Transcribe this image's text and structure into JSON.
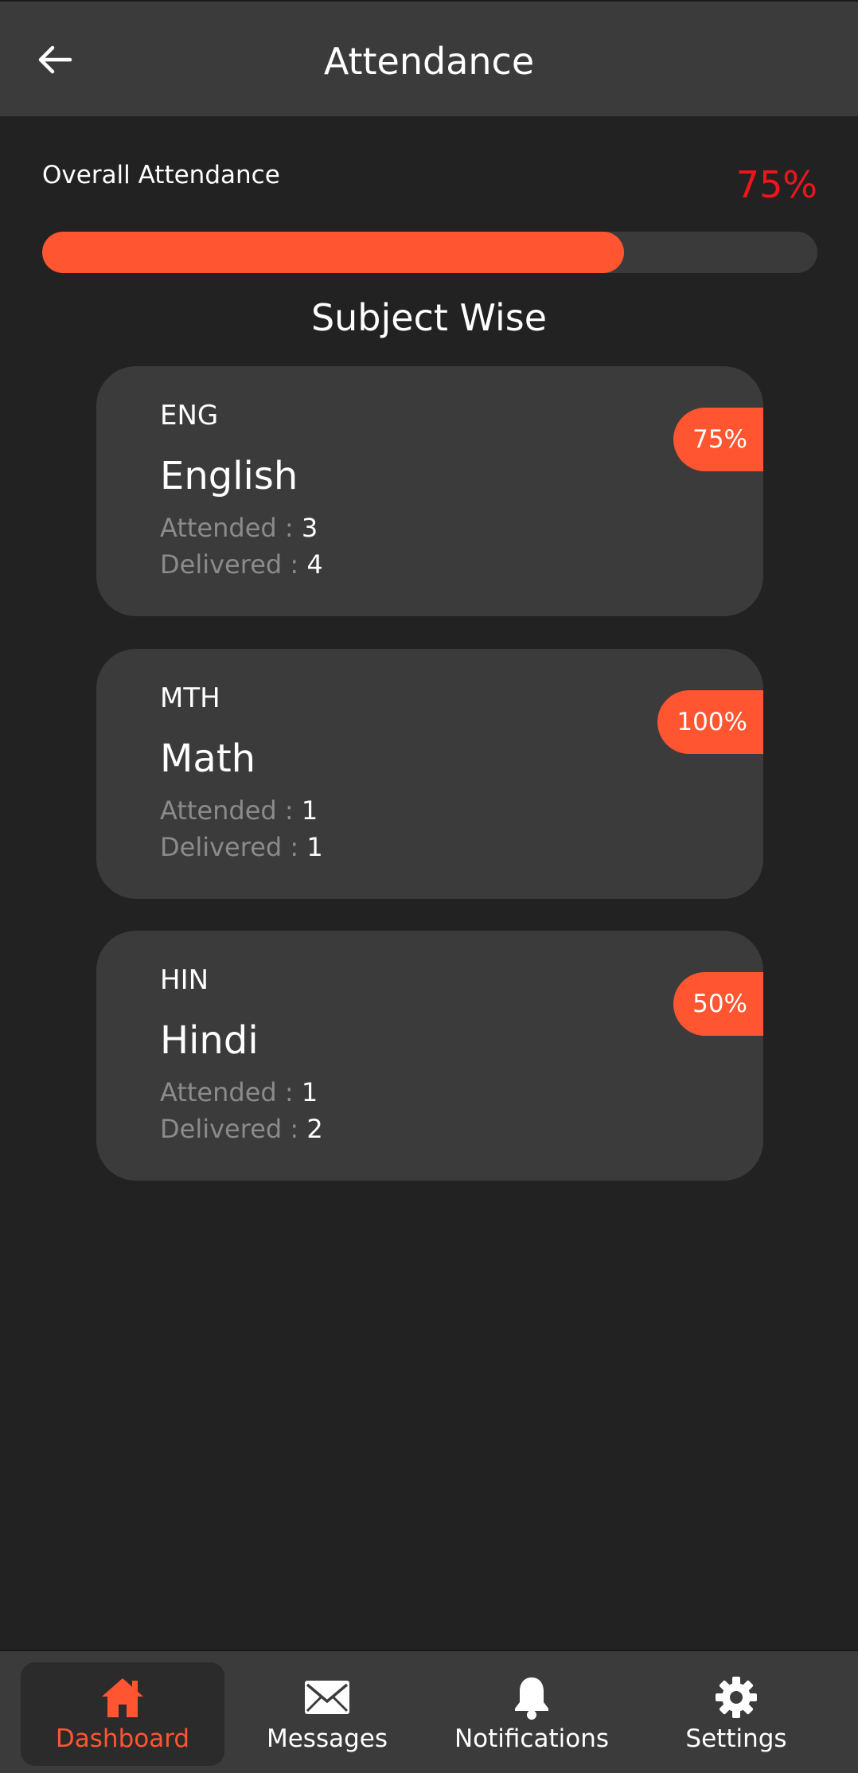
{
  "appbar": {
    "title": "Attendance",
    "back_icon": "arrow-left-icon"
  },
  "overall": {
    "label": "Overall Attendance",
    "percent_text": "75%",
    "progress_fraction": 0.75
  },
  "section_title": "Subject Wise",
  "subjects": [
    {
      "code": "ENG",
      "name": "English",
      "attended_label": "Attended : ",
      "attended": "3",
      "delivered_label": "Delivered : ",
      "delivered": "4",
      "badge": "75%"
    },
    {
      "code": "MTH",
      "name": "Math",
      "attended_label": "Attended : ",
      "attended": "1",
      "delivered_label": "Delivered : ",
      "delivered": "1",
      "badge": "100%"
    },
    {
      "code": "HIN",
      "name": "Hindi",
      "attended_label": "Attended : ",
      "attended": "1",
      "delivered_label": "Delivered : ",
      "delivered": "2",
      "badge": "50%"
    }
  ],
  "bottom_nav": [
    {
      "label": "Dashboard",
      "icon": "home-icon",
      "active": true
    },
    {
      "label": "Messages",
      "icon": "envelope-icon",
      "active": false
    },
    {
      "label": "Notifications",
      "icon": "bell-icon",
      "active": false
    },
    {
      "label": "Settings",
      "icon": "gear-icon",
      "active": false
    }
  ],
  "colors": {
    "accent": "#ff5530",
    "overall_percent": "#f0141c",
    "background": "#222222",
    "surface": "#3b3b3b"
  }
}
